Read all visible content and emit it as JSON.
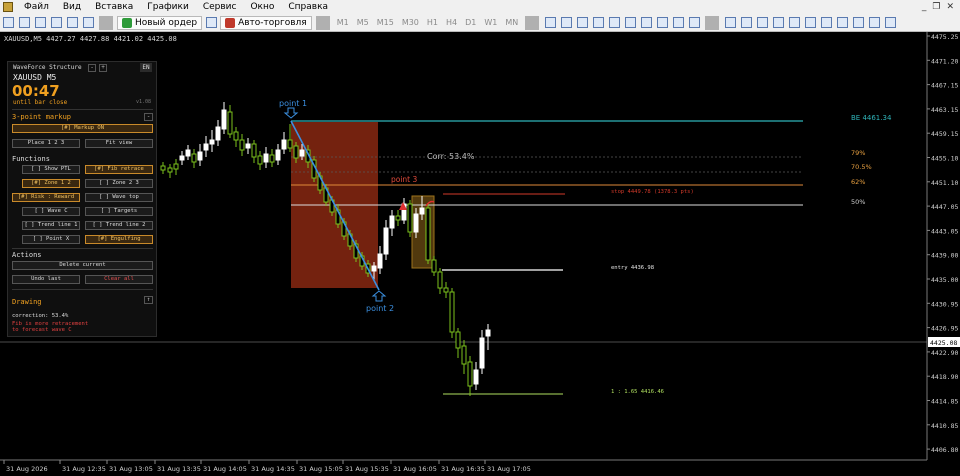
{
  "menu": {
    "items": [
      "Файл",
      "Вид",
      "Вставка",
      "Графики",
      "Сервис",
      "Окно",
      "Справка"
    ],
    "window_controls": [
      "_",
      "❐",
      "✕"
    ]
  },
  "toolbar": {
    "new_order": "Новый ордер",
    "auto_trading": "Авто-торговля",
    "timeframes": [
      "M1",
      "M5",
      "M15",
      "M30",
      "H1",
      "H4",
      "D1",
      "W1",
      "MN"
    ]
  },
  "chart": {
    "symbol_line": "XAUUSD,M5 4427.27 4427.88 4421.02 4425.08",
    "price_ticks": [
      "4475.25",
      "4471.20",
      "4467.15",
      "4463.15",
      "4459.15",
      "4455.10",
      "4451.10",
      "4447.05",
      "4443.05",
      "4439.00",
      "4435.00",
      "4430.95",
      "4426.95",
      "4422.90",
      "4418.90",
      "4414.85",
      "4410.85",
      "4406.80"
    ],
    "current_price": "4425.08",
    "time_ticks": [
      "31 Aug 2026",
      "31 Aug 12:35",
      "31 Aug 13:05",
      "31 Aug 13:35",
      "31 Aug 14:05",
      "31 Aug 14:35",
      "31 Aug 15:05",
      "31 Aug 15:35",
      "31 Aug 16:05",
      "31 Aug 16:35",
      "31 Aug 17:05"
    ],
    "annotations": {
      "point1": "point 1",
      "point2": "point 2",
      "point3": "point 3",
      "corr": "Corr: 53.4%",
      "be": "BE  4461.34",
      "fib79": "79%",
      "fib705": "70.5%",
      "fib62": "62%",
      "fib50": "50%",
      "stop": "stop  4449.78  (1378.3 pts)",
      "entry": "entry  4436.98",
      "target": "1 : 1.65   4416.46"
    },
    "colors": {
      "bull": "#ffffff",
      "bear": "#7cc21d",
      "zone": "#7a2410",
      "be_line": "#2fb3b8",
      "fib": "#e08a3a",
      "stop": "#d23a2a"
    }
  },
  "panel": {
    "title": "WaveForce Structure",
    "mini_buttons": [
      "-",
      "+"
    ],
    "lang": "EN",
    "symbol": "XAUUSD  M5",
    "timer": "00:47",
    "until": "until bar close",
    "version": "v1.08",
    "sec_markup": "3-point markup",
    "markup_on": "[#] Markup ON",
    "place": "Place 1 2 3",
    "fit": "Fit view",
    "sec_functions": "Functions",
    "functions": [
      "[ ] Show PTL",
      "[#] Fib retrace",
      "[#] Zone 1 2",
      "[ ] Zone 2 3",
      "[#] Risk : Reward",
      "[ ] Wave top",
      "[ ] Wave C",
      "[ ] Targets",
      "[ ] Trend line 1",
      "[ ] Trend line 2",
      "[ ] Point X",
      "[#] Engulfing"
    ],
    "sec_actions": "Actions",
    "delete_current": "Delete current",
    "undo_last": "Undo last",
    "clear_all": "Clear all",
    "sec_drawing": "Drawing",
    "correction": "correction: 53.4%",
    "warn1": "Fib is more retracement",
    "warn2": "to forecast wave C"
  }
}
